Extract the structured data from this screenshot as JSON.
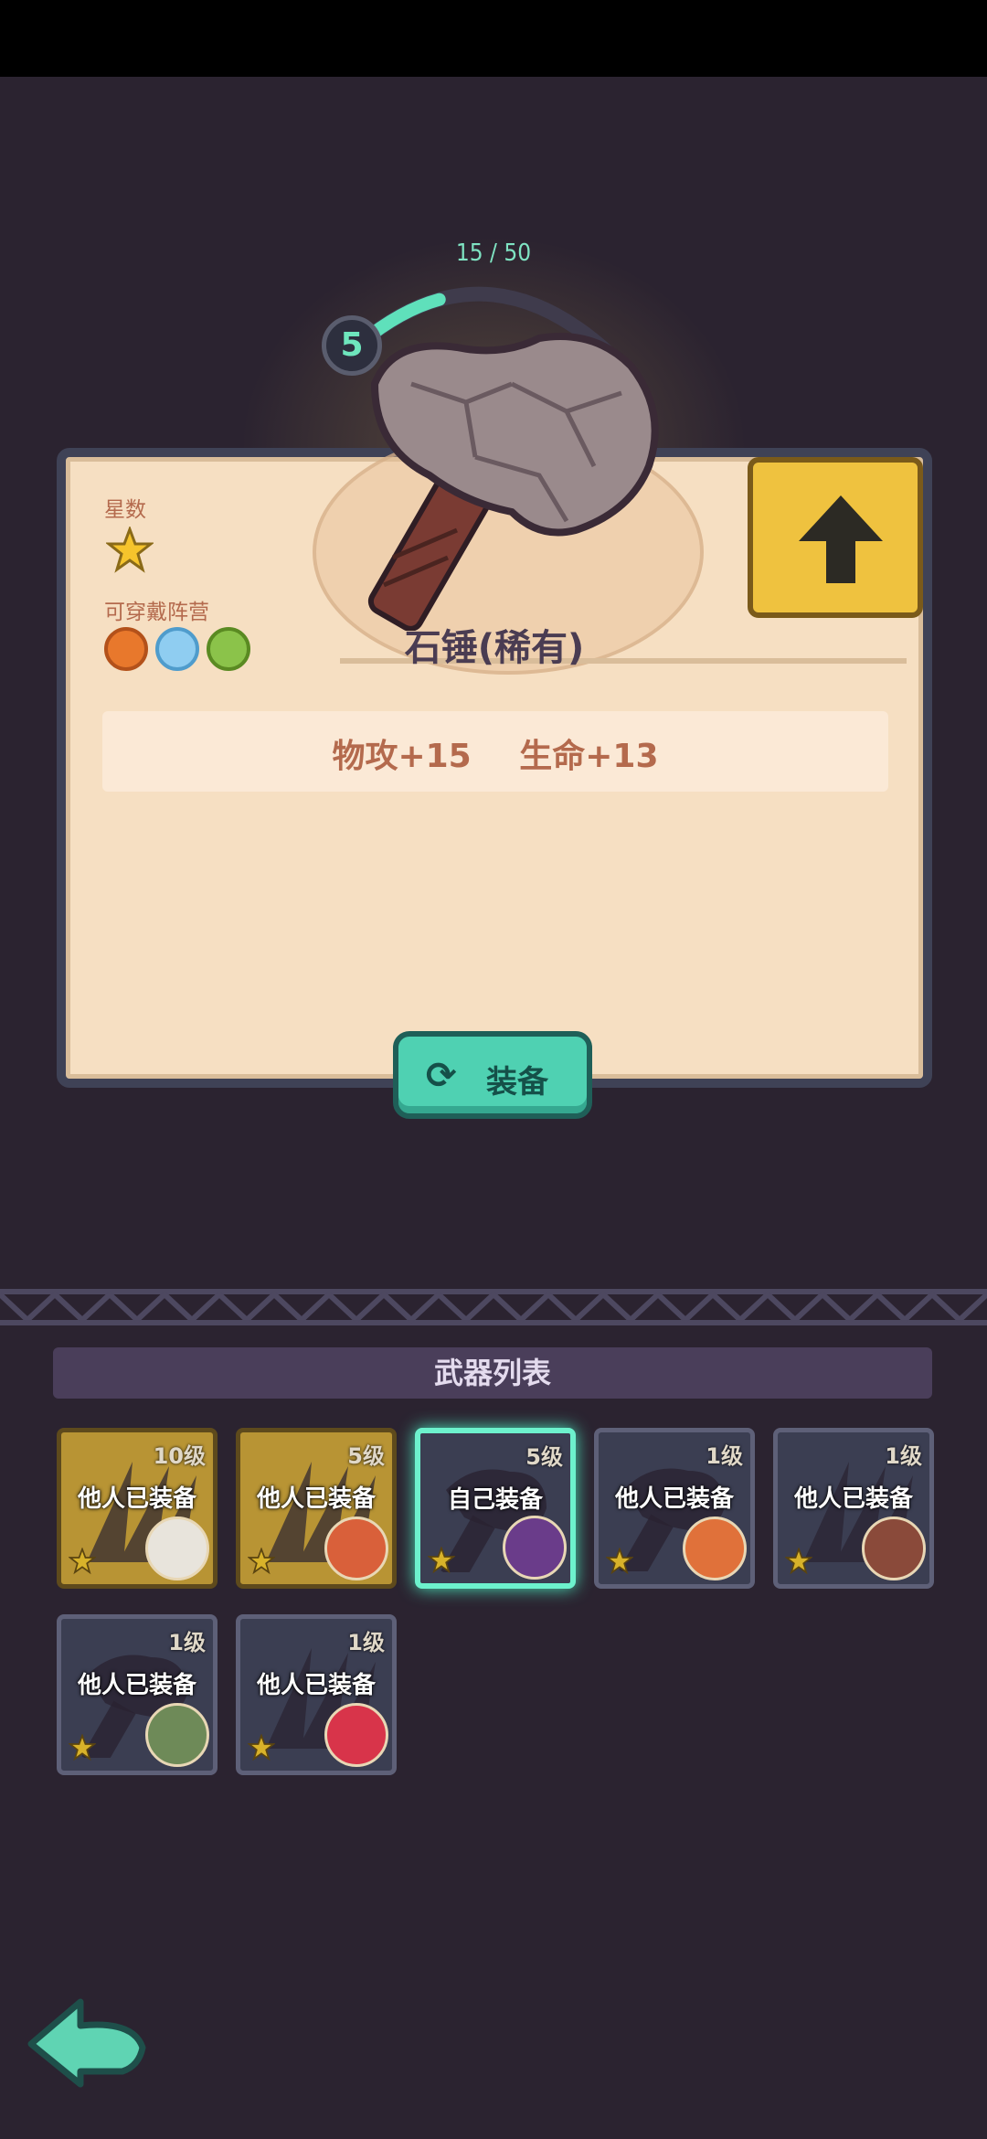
{
  "progress": {
    "text": "15 / 50",
    "value": 15,
    "max": 50,
    "level": "5"
  },
  "item": {
    "stars_label": "星数",
    "camp_label": "可穿戴阵营",
    "camp_icons": [
      "gear-icon",
      "pod-icon",
      "paw-icon"
    ],
    "name": "石锤(稀有)",
    "stats": "物攻+15 生命+13",
    "star_count": 1
  },
  "buttons": {
    "equip": "装备",
    "upgrade": "upgrade-arrow-icon",
    "back": "back-arrow-icon"
  },
  "list": {
    "title": "武器列表",
    "slots": [
      {
        "level": "10级",
        "status": "他人已装备",
        "frame": "gold",
        "weapon": "claw",
        "avatar_color": "#e8e4dc"
      },
      {
        "level": "5级",
        "status": "他人已装备",
        "frame": "gold",
        "weapon": "claw",
        "avatar_color": "#d9603a"
      },
      {
        "level": "5级",
        "status": "自己装备",
        "frame": "selected",
        "weapon": "hammer",
        "avatar_color": "#6a3c8a"
      },
      {
        "level": "1级",
        "status": "他人已装备",
        "frame": "grey",
        "weapon": "hammer",
        "avatar_color": "#e0713a"
      },
      {
        "level": "1级",
        "status": "他人已装备",
        "frame": "grey",
        "weapon": "claw",
        "avatar_color": "#8a4a3a"
      },
      {
        "level": "1级",
        "status": "他人已装备",
        "frame": "grey",
        "weapon": "hammer",
        "avatar_color": "#6e8a58"
      },
      {
        "level": "1级",
        "status": "他人已装备",
        "frame": "grey",
        "weapon": "claw",
        "avatar_color": "#d8344a"
      }
    ]
  },
  "colors": {
    "accent": "#4fd1b2",
    "card": "#f6dfc2",
    "gold": "#efc23f",
    "bg": "#2b2330"
  }
}
